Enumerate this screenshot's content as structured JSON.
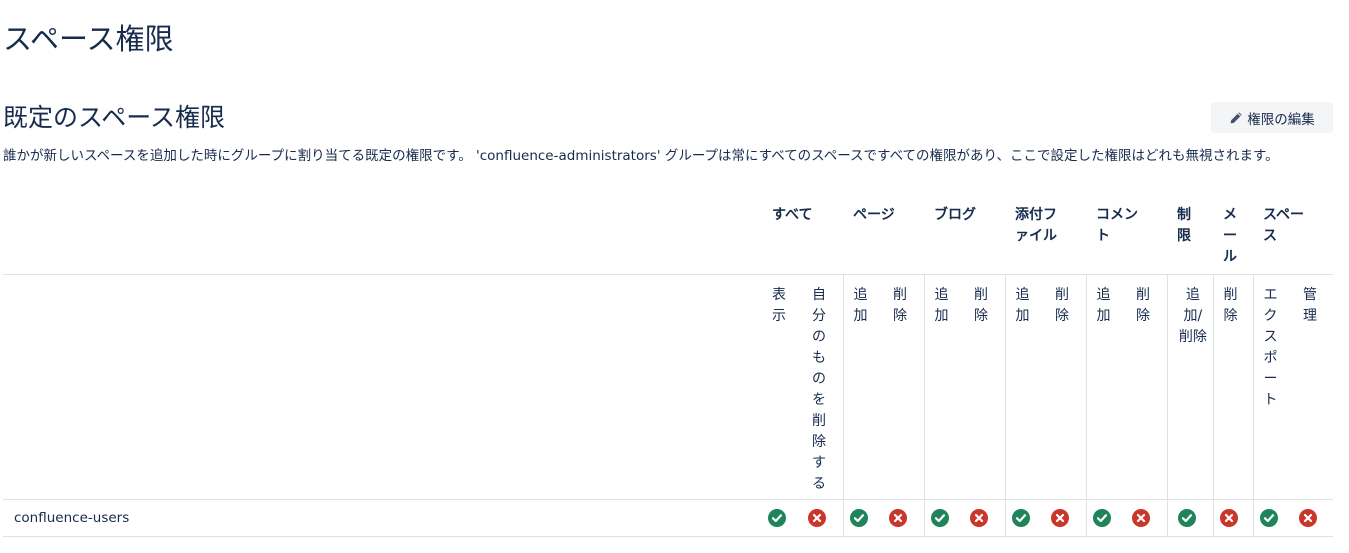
{
  "page": {
    "title": "スペース権限",
    "section_title": "既定のスペース権限",
    "edit_button_label": "権限の編集",
    "description": "誰かが新しいスペースを追加した時にグループに割り当てる既定の権限です。 'confluence-administrators' グループは常にすべてのスペースですべての権限があり、ここで設定した権限はどれも無視されます。"
  },
  "table": {
    "groups": [
      {
        "label": "すべて"
      },
      {
        "label": "ページ"
      },
      {
        "label": "ブログ"
      },
      {
        "label": "添付ファイル"
      },
      {
        "label": "コメント"
      },
      {
        "label": "制限"
      },
      {
        "label": "メール"
      },
      {
        "label": "スペース"
      }
    ],
    "subheaders": [
      "表示",
      "自分のものを削除する",
      "追加",
      "削除",
      "追加",
      "削除",
      "追加",
      "削除",
      "追加",
      "削除",
      "追加/削除",
      "削除",
      "エクスポート",
      "管理"
    ],
    "rows": [
      {
        "group": "confluence-users",
        "permissions": [
          true,
          false,
          true,
          false,
          true,
          false,
          true,
          false,
          true,
          false,
          true,
          false,
          true,
          false
        ]
      }
    ]
  },
  "colors": {
    "granted": "#1f845a",
    "denied": "#c9372c",
    "text": "#172b4d",
    "border": "#dfe1e6",
    "button_bg": "#f4f5f7"
  },
  "icons": {
    "edit": "pencil-icon",
    "granted": "check-circle-icon",
    "denied": "cross-circle-icon"
  }
}
